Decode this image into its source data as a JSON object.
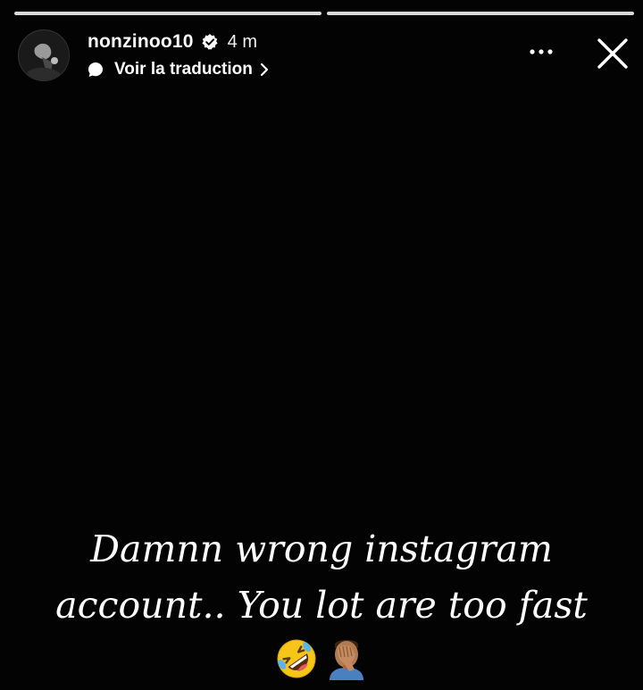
{
  "story": {
    "progress": [
      1.0,
      1.0
    ]
  },
  "header": {
    "username": "nonzinoo10",
    "time": "4 m",
    "translate_label": "Voir la traduction",
    "icons": {
      "verified": "verified-badge-icon",
      "translate": "translate-icon",
      "chevron": "chevron-right-icon",
      "more": "more-options-icon",
      "close": "close-icon"
    }
  },
  "caption": {
    "line1": "Damnn wrong instagram",
    "line2": "account.. You lot are too fast"
  },
  "emojis": {
    "first": "rolling-on-floor-laughing-emoji",
    "second": "man-facepalming-emoji"
  }
}
